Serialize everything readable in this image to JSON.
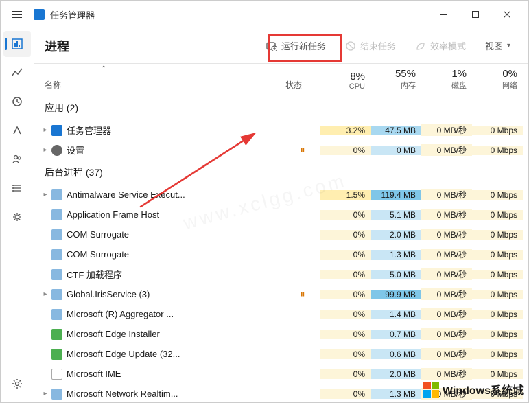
{
  "app": {
    "title": "任务管理器"
  },
  "page": {
    "title": "进程"
  },
  "toolbar": {
    "run_new_task": "运行新任务",
    "end_task": "结束任务",
    "efficiency_mode": "效率模式",
    "view": "视图"
  },
  "columns": {
    "name": "名称",
    "status": "状态",
    "cpu": {
      "pct": "8%",
      "label": "CPU"
    },
    "memory": {
      "pct": "55%",
      "label": "内存"
    },
    "disk": {
      "pct": "1%",
      "label": "磁盘"
    },
    "network": {
      "pct": "0%",
      "label": "网络"
    }
  },
  "groups": {
    "apps": "应用 (2)",
    "bg": "后台进程 (37)"
  },
  "rows": [
    {
      "name": "任务管理器",
      "expand": true,
      "cpu": "3.2%",
      "mem": "47.5 MB",
      "disk": "0 MB/秒",
      "net": "0 Mbps",
      "cpu_heat": 2,
      "mem_heat": 5
    },
    {
      "name": "设置",
      "expand": true,
      "paused": true,
      "cpu": "0%",
      "mem": "0 MB",
      "disk": "0 MB/秒",
      "net": "0 Mbps",
      "cpu_heat": 1,
      "mem_heat": 4,
      "icon": "gear"
    },
    {
      "name": "Antimalware Service Execut...",
      "expand": true,
      "cpu": "1.5%",
      "mem": "119.4 MB",
      "disk": "0 MB/秒",
      "net": "0 Mbps",
      "cpu_heat": 2,
      "mem_heat": 6,
      "icon": "generic"
    },
    {
      "name": "Application Frame Host",
      "cpu": "0%",
      "mem": "5.1 MB",
      "disk": "0 MB/秒",
      "net": "0 Mbps",
      "cpu_heat": 1,
      "mem_heat": 4,
      "icon": "generic"
    },
    {
      "name": "COM Surrogate",
      "cpu": "0%",
      "mem": "2.0 MB",
      "disk": "0 MB/秒",
      "net": "0 Mbps",
      "cpu_heat": 1,
      "mem_heat": 4,
      "icon": "generic"
    },
    {
      "name": "COM Surrogate",
      "cpu": "0%",
      "mem": "1.3 MB",
      "disk": "0 MB/秒",
      "net": "0 Mbps",
      "cpu_heat": 1,
      "mem_heat": 4,
      "icon": "generic"
    },
    {
      "name": "CTF 加载程序",
      "cpu": "0%",
      "mem": "5.0 MB",
      "disk": "0 MB/秒",
      "net": "0 Mbps",
      "cpu_heat": 1,
      "mem_heat": 4,
      "icon": "generic"
    },
    {
      "name": "Global.IrisService (3)",
      "expand": true,
      "paused": true,
      "cpu": "0%",
      "mem": "99.9 MB",
      "disk": "0 MB/秒",
      "net": "0 Mbps",
      "cpu_heat": 1,
      "mem_heat": 6,
      "icon": "generic"
    },
    {
      "name": "Microsoft (R) Aggregator ...",
      "cpu": "0%",
      "mem": "1.4 MB",
      "disk": "0 MB/秒",
      "net": "0 Mbps",
      "cpu_heat": 1,
      "mem_heat": 4,
      "icon": "generic"
    },
    {
      "name": "Microsoft Edge Installer",
      "cpu": "0%",
      "mem": "0.7 MB",
      "disk": "0 MB/秒",
      "net": "0 Mbps",
      "cpu_heat": 1,
      "mem_heat": 4,
      "icon": "edge"
    },
    {
      "name": "Microsoft Edge Update (32...",
      "cpu": "0%",
      "mem": "0.6 MB",
      "disk": "0 MB/秒",
      "net": "0 Mbps",
      "cpu_heat": 1,
      "mem_heat": 4,
      "icon": "edge"
    },
    {
      "name": "Microsoft IME",
      "cpu": "0%",
      "mem": "2.0 MB",
      "disk": "0 MB/秒",
      "net": "0 Mbps",
      "cpu_heat": 1,
      "mem_heat": 4,
      "icon": "ime"
    },
    {
      "name": "Microsoft Network Realtim...",
      "expand": true,
      "cpu": "0%",
      "mem": "1.3 MB",
      "disk": "0 MB/秒",
      "net": "0 Mbps",
      "cpu_heat": 1,
      "mem_heat": 4,
      "icon": "generic"
    }
  ],
  "watermark": {
    "text": "Windows系统城",
    "url": "www.xclgg.com"
  }
}
